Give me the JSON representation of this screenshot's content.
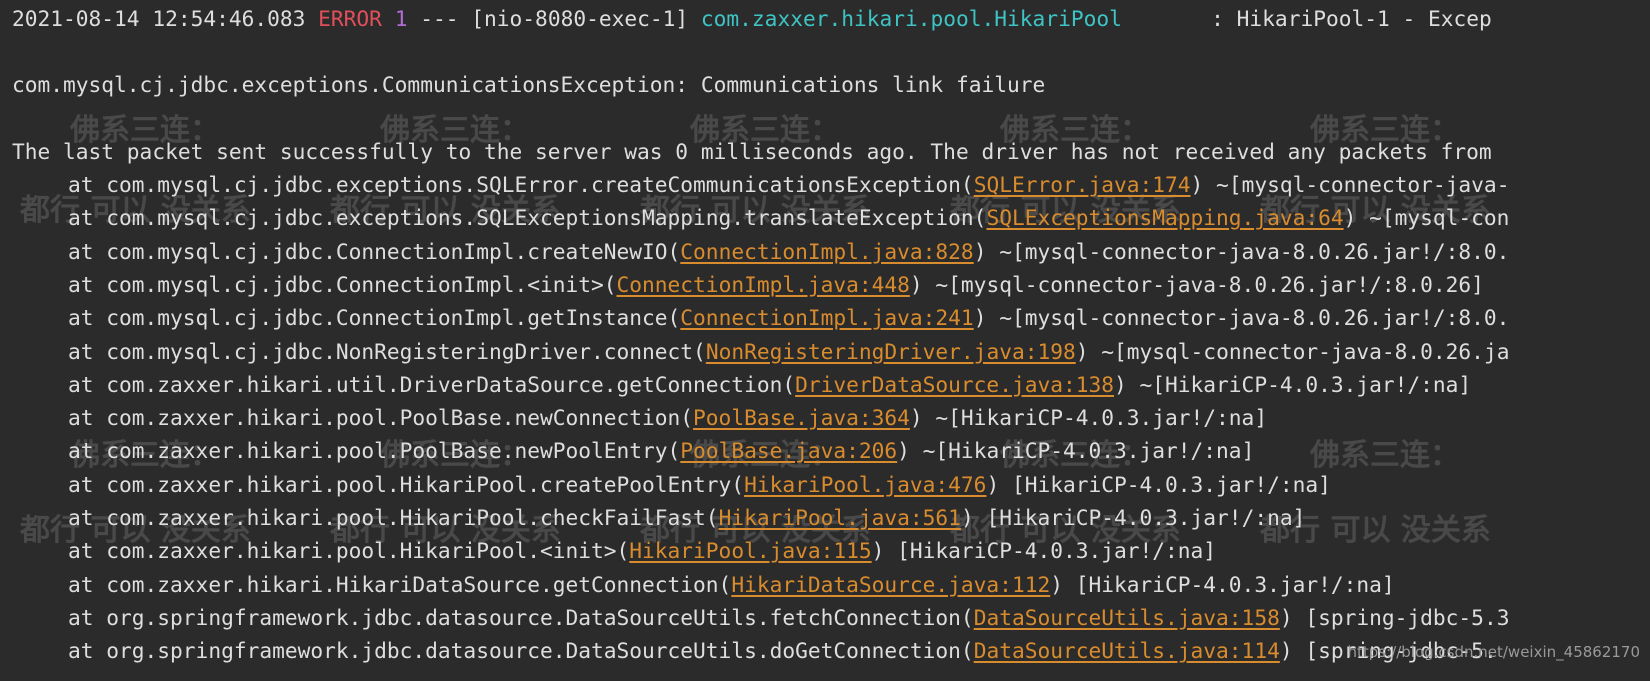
{
  "header_line": {
    "timestamp": "2021-08-14 12:54:46.083",
    "level": "ERROR",
    "pid": "1",
    "separator": "---",
    "thread": "[nio-8080-exec-1]",
    "logger": "com.zaxxer.hikari.pool.HikariPool",
    "message": ": HikariPool-1 - Excep"
  },
  "exception_line": "com.mysql.cj.jdbc.exceptions.CommunicationsException: Communications link failure",
  "detail_line": "The last packet sent successfully to the server was 0 milliseconds ago. The driver has not received any packets from",
  "stack": [
    {
      "method": "at com.mysql.cj.jdbc.exceptions.SQLError.createCommunicationsException(",
      "link": "SQLError.java:174",
      "suffix": ") ~[mysql-connector-java-"
    },
    {
      "method": "at com.mysql.cj.jdbc.exceptions.SQLExceptionsMapping.translateException(",
      "link": "SQLExceptionsMapping.java:64",
      "suffix": ") ~[mysql-con"
    },
    {
      "method": "at com.mysql.cj.jdbc.ConnectionImpl.createNewIO(",
      "link": "ConnectionImpl.java:828",
      "suffix": ") ~[mysql-connector-java-8.0.26.jar!/:8.0."
    },
    {
      "method": "at com.mysql.cj.jdbc.ConnectionImpl.<init>(",
      "link": "ConnectionImpl.java:448",
      "suffix": ") ~[mysql-connector-java-8.0.26.jar!/:8.0.26]"
    },
    {
      "method": "at com.mysql.cj.jdbc.ConnectionImpl.getInstance(",
      "link": "ConnectionImpl.java:241",
      "suffix": ") ~[mysql-connector-java-8.0.26.jar!/:8.0."
    },
    {
      "method": "at com.mysql.cj.jdbc.NonRegisteringDriver.connect(",
      "link": "NonRegisteringDriver.java:198",
      "suffix": ") ~[mysql-connector-java-8.0.26.ja"
    },
    {
      "method": "at com.zaxxer.hikari.util.DriverDataSource.getConnection(",
      "link": "DriverDataSource.java:138",
      "suffix": ") ~[HikariCP-4.0.3.jar!/:na]"
    },
    {
      "method": "at com.zaxxer.hikari.pool.PoolBase.newConnection(",
      "link": "PoolBase.java:364",
      "suffix": ") ~[HikariCP-4.0.3.jar!/:na]"
    },
    {
      "method": "at com.zaxxer.hikari.pool.PoolBase.newPoolEntry(",
      "link": "PoolBase.java:206",
      "suffix": ") ~[HikariCP-4.0.3.jar!/:na]"
    },
    {
      "method": "at com.zaxxer.hikari.pool.HikariPool.createPoolEntry(",
      "link": "HikariPool.java:476",
      "suffix": ") [HikariCP-4.0.3.jar!/:na]"
    },
    {
      "method": "at com.zaxxer.hikari.pool.HikariPool.checkFailFast(",
      "link": "HikariPool.java:561",
      "suffix": ") [HikariCP-4.0.3.jar!/:na]"
    },
    {
      "method": "at com.zaxxer.hikari.pool.HikariPool.<init>(",
      "link": "HikariPool.java:115",
      "suffix": ") [HikariCP-4.0.3.jar!/:na]"
    },
    {
      "method": "at com.zaxxer.hikari.HikariDataSource.getConnection(",
      "link": "HikariDataSource.java:112",
      "suffix": ") [HikariCP-4.0.3.jar!/:na]"
    },
    {
      "method": "at org.springframework.jdbc.datasource.DataSourceUtils.fetchConnection(",
      "link": "DataSourceUtils.java:158",
      "suffix": ") [spring-jdbc-5.3"
    },
    {
      "method": "at org.springframework.jdbc.datasource.DataSourceUtils.doGetConnection(",
      "link": "DataSourceUtils.java:114",
      "suffix": ") [spring-jdbc-5."
    }
  ],
  "watermark": {
    "phrase_a": "佛系三连：",
    "phrase_b": "都行 可以 没关系"
  },
  "csdn_watermark": "https://blog.csdn.net/weixin_45862170",
  "colors": {
    "background": "#2b2b2b",
    "text": "#dedede",
    "error": "#e0505a",
    "pid": "#b36bd6",
    "logger": "#3ec4c4",
    "link": "#d98c2e"
  }
}
